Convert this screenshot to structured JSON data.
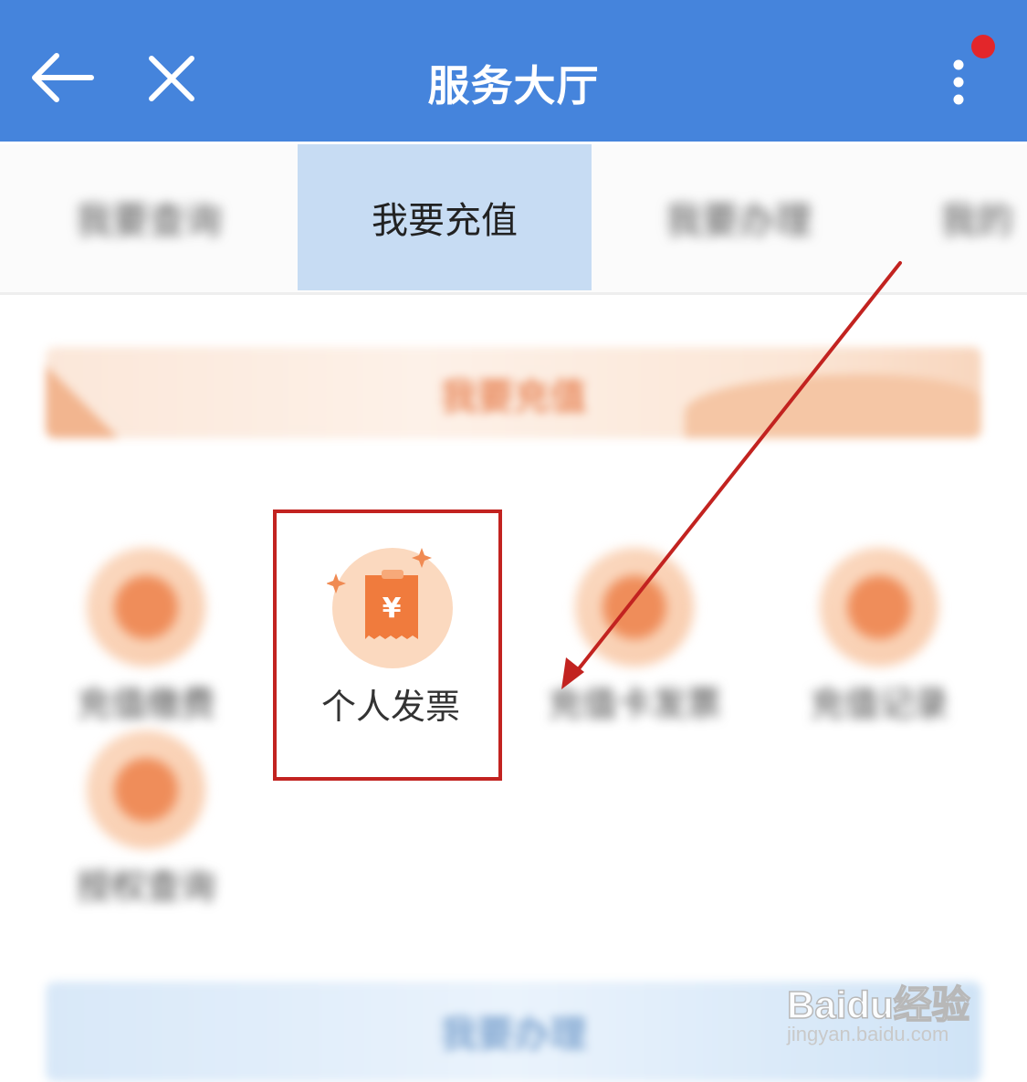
{
  "header": {
    "title": "服务大厅",
    "accent_color": "#4584dc",
    "back_icon": "arrow-left-icon",
    "close_icon": "close-icon",
    "more_icon": "more-vertical-icon",
    "notification_dot_color": "#e3262a"
  },
  "tabs": [
    {
      "label": "我要查询",
      "active": false,
      "blurred": true
    },
    {
      "label": "我要充值",
      "active": true,
      "blurred": false
    },
    {
      "label": "我要办理",
      "active": false,
      "blurred": true
    },
    {
      "label": "我的",
      "active": false,
      "blurred": true
    }
  ],
  "banner": {
    "title": "我要充值"
  },
  "services": [
    {
      "label": "充值缴费",
      "icon": "recharge-icon",
      "blurred": true
    },
    {
      "label": "个人发票",
      "icon": "invoice-yuan-icon",
      "blurred": false,
      "highlighted": true
    },
    {
      "label": "充值卡发票",
      "icon": "card-invoice-icon",
      "blurred": true
    },
    {
      "label": "充值记录",
      "icon": "record-icon",
      "blurred": true
    },
    {
      "label": "授权查询",
      "icon": "user-icon",
      "blurred": true
    }
  ],
  "invoice_icon_symbol": "¥",
  "bottom_card": {
    "title": "我要办理"
  },
  "annotation": {
    "color": "#c22320"
  },
  "watermark": {
    "main": "Baidu经验",
    "sub": "jingyan.baidu.com"
  }
}
